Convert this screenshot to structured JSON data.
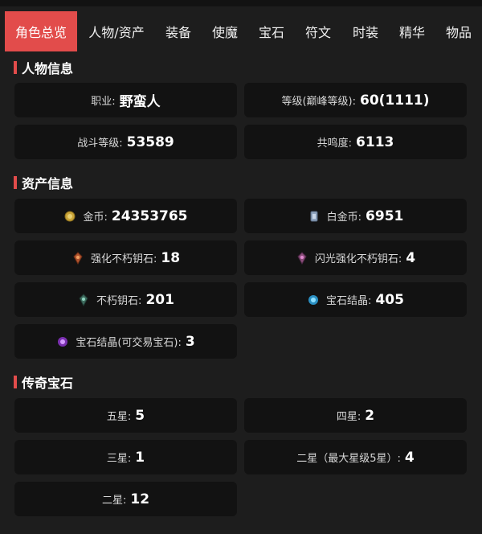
{
  "tabs": [
    {
      "label": "角色总览",
      "active": true
    },
    {
      "label": "人物/资产",
      "active": false
    },
    {
      "label": "装备",
      "active": false
    },
    {
      "label": "使魔",
      "active": false
    },
    {
      "label": "宝石",
      "active": false
    },
    {
      "label": "符文",
      "active": false
    },
    {
      "label": "时装",
      "active": false
    },
    {
      "label": "精华",
      "active": false
    },
    {
      "label": "物品",
      "active": false
    }
  ],
  "character": {
    "title": "人物信息",
    "class_label": "职业:",
    "class_value": "野蛮人",
    "level_label": "等级(巅峰等级):",
    "level_value": "60(1111)",
    "combat_label": "战斗等级:",
    "combat_value": "53589",
    "resonance_label": "共鸣度:",
    "resonance_value": "6113"
  },
  "assets": {
    "title": "资产信息",
    "gold_label": "金币:",
    "gold_value": "24353765",
    "platinum_label": "白金币:",
    "platinum_value": "6951",
    "enhance_label": "强化不朽钥石:",
    "enhance_value": "18",
    "shiny_enhance_label": "闪光强化不朽钥石:",
    "shiny_enhance_value": "4",
    "immortal_label": "不朽钥石:",
    "immortal_value": "201",
    "crystal_label": "宝石结晶:",
    "crystal_value": "405",
    "tradable_crystal_label": "宝石结晶(可交易宝石):",
    "tradable_crystal_value": "3"
  },
  "legendary": {
    "title": "传奇宝石",
    "five_label": "五星:",
    "five_value": "5",
    "four_label": "四星:",
    "four_value": "2",
    "three_label": "三星:",
    "three_value": "1",
    "two_max_label": "二星（最大星级5星）:",
    "two_max_value": "4",
    "two_label": "二星:",
    "two_value": "12"
  },
  "colors": {
    "accent": "#e24c4b",
    "card": "#121212",
    "background": "#1d1d1d"
  },
  "icons": [
    "gold-coin-icon",
    "platinum-coin-icon",
    "enhance-key-icon",
    "shiny-enhance-key-icon",
    "immortal-key-icon",
    "gem-crystal-icon",
    "tradable-gem-crystal-icon"
  ]
}
